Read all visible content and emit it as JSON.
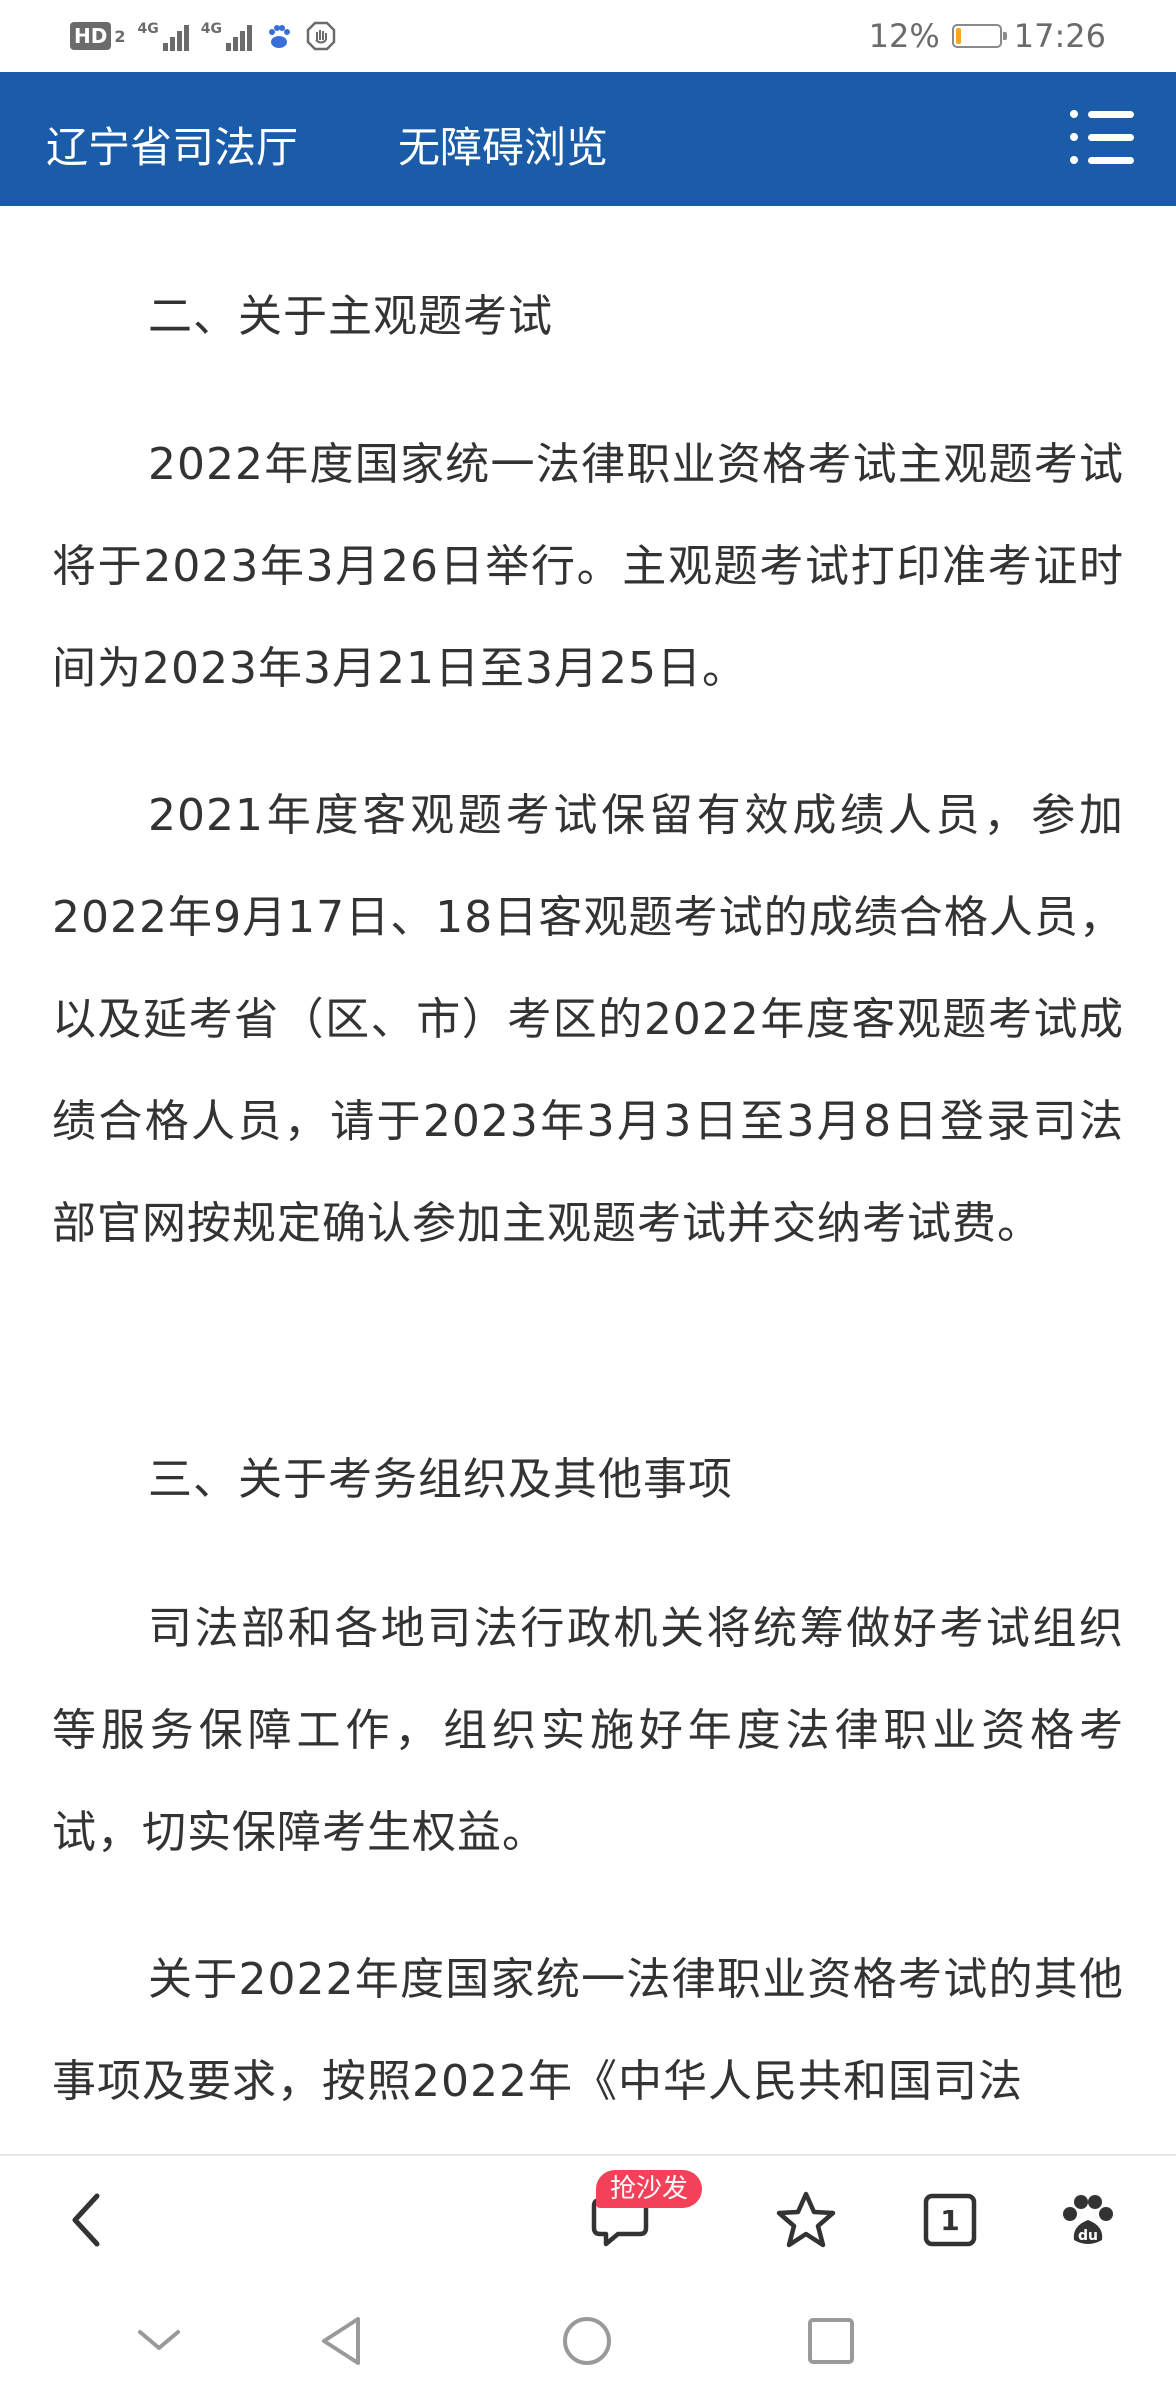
{
  "status_bar": {
    "hd_label": "HD",
    "hd_sub": "2",
    "signal1_label": "4G",
    "signal2_label": "4G",
    "battery_percent_text": "12%",
    "battery_level": 0.12,
    "time": "17:26",
    "icons": [
      "baidu-paw-icon",
      "hand-stop-icon"
    ]
  },
  "header": {
    "site_title": "辽宁省司法厅",
    "accessibility_link": "无障碍浏览",
    "menu_icon": "menu-list-icon",
    "bg_color": "#1a5ca8"
  },
  "article": {
    "paragraphs": [
      "二、关于主观题考试",
      "2022年度国家统一法律职业资格考试主观题考试将于2023年3月26日举行。主观题考试打印准考证时间为2023年3月21日至3月25日。",
      "2021年度客观题考试保留有效成绩人员，参加2022年9月17日、18日客观题考试的成绩合格人员，以及延考省（区、市）考区的2022年度客观题考试成绩合格人员，请于2023年3月3日至3月8日登录司法部官网按规定确认参加主观题考试并交纳考试费。",
      "三、关于考务组织及其他事项",
      "司法部和各地司法行政机关将统筹做好考试组织等服务保障工作，组织实施好年度法律职业资格考试，切实保障考生权益。",
      "关于2022年度国家统一法律职业资格考试的其他事项及要求，按照2022年《中华人民共和国司法"
    ]
  },
  "toolbar": {
    "back_icon": "chevron-left-icon",
    "comment_icon": "comment-bubble-icon",
    "comment_badge": "抢沙发",
    "favorite_icon": "star-icon",
    "tabs_count": "1",
    "baidu_icon": "baidu-paw-icon",
    "badge_color": "#f5405a"
  },
  "system_nav": {
    "icons": [
      "hide-chevron-icon",
      "back-triangle-icon",
      "home-circle-icon",
      "recents-square-icon"
    ]
  }
}
